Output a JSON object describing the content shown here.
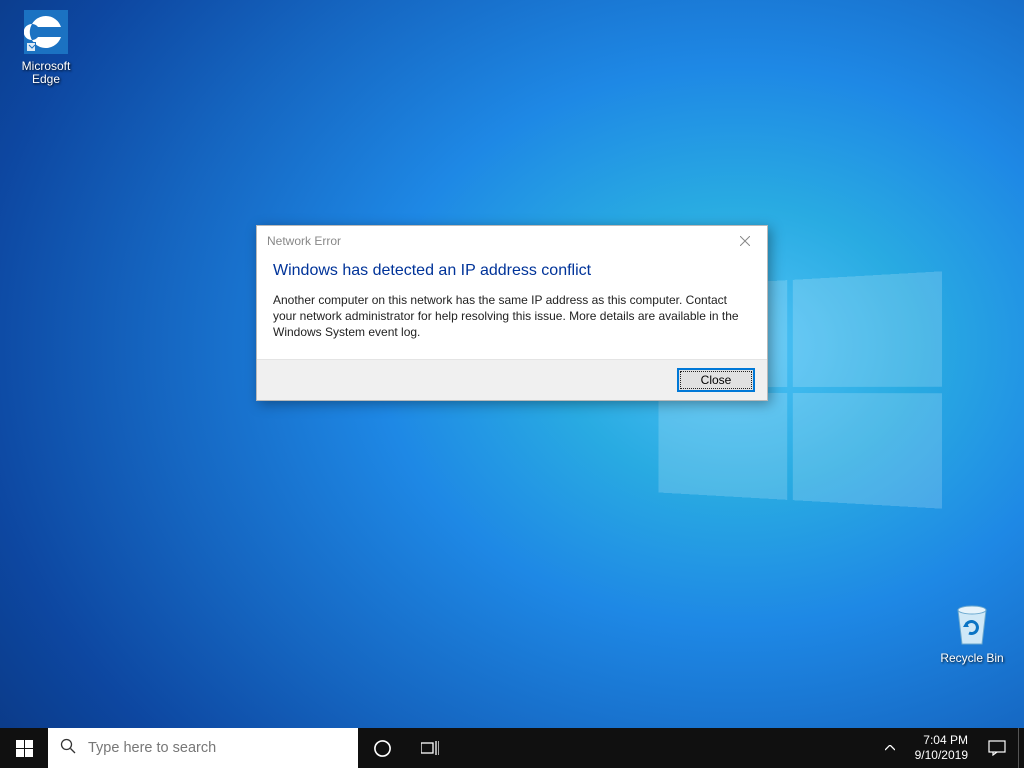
{
  "desktop": {
    "icons": {
      "edge": "Microsoft Edge",
      "recycle": "Recycle Bin"
    }
  },
  "dialog": {
    "title": "Network Error",
    "heading": "Windows has detected an IP address conflict",
    "body": "Another computer on this network has the same IP address as this computer. Contact your network administrator for help resolving this issue. More details are available in the Windows System event log.",
    "close_button": "Close"
  },
  "taskbar": {
    "search_placeholder": "Type here to search",
    "clock": {
      "time": "7:04 PM",
      "date": "9/10/2019"
    }
  }
}
